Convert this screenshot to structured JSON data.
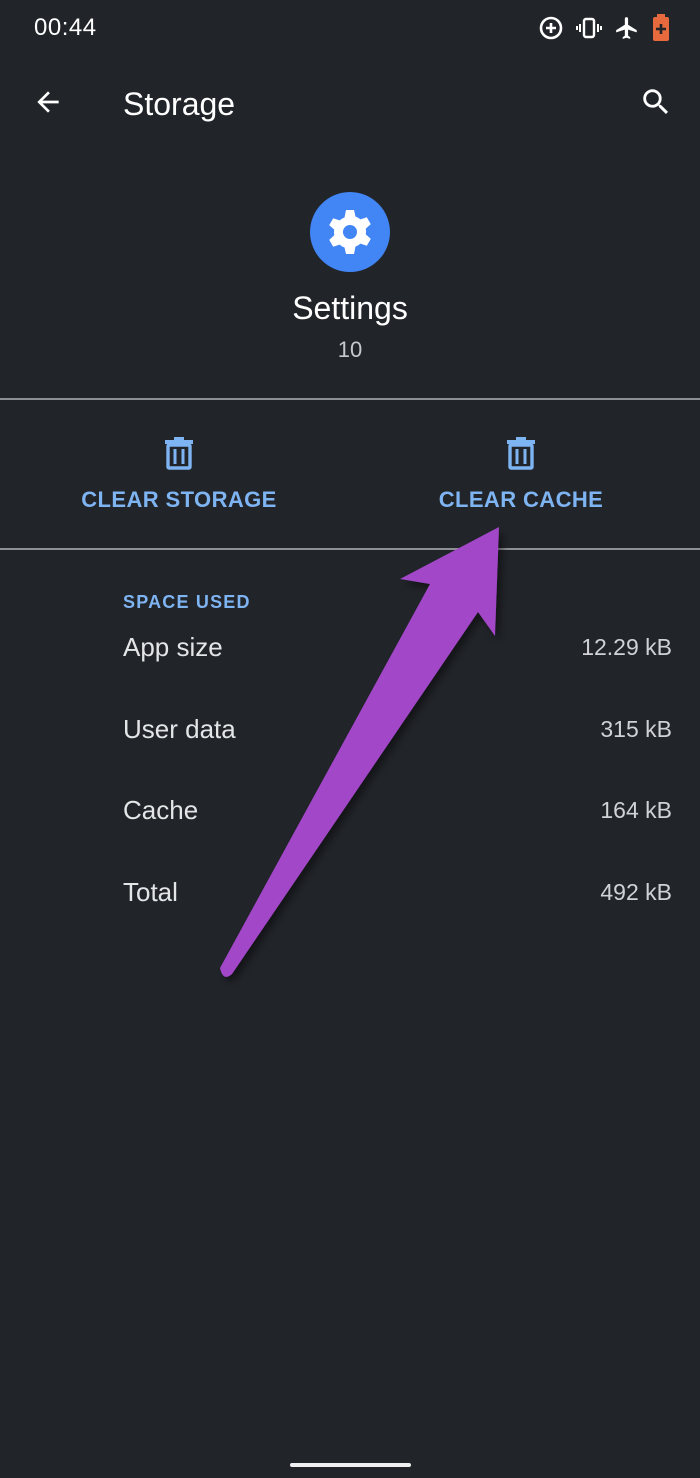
{
  "status_bar": {
    "time": "00:44",
    "icons": [
      "data-saver-icon",
      "vibrate-icon",
      "airplane-icon",
      "battery-saver-icon"
    ]
  },
  "app_bar": {
    "title": "Storage",
    "back_icon": "arrow-left-icon",
    "search_icon": "search-icon"
  },
  "app_info": {
    "name": "Settings",
    "version": "10",
    "icon": "gear-icon"
  },
  "actions": {
    "clear_storage": "CLEAR STORAGE",
    "clear_cache": "CLEAR CACHE"
  },
  "space_used": {
    "header": "SPACE USED",
    "rows": [
      {
        "label": "App size",
        "value": "12.29 kB"
      },
      {
        "label": "User data",
        "value": "315 kB"
      },
      {
        "label": "Cache",
        "value": "164 kB"
      },
      {
        "label": "Total",
        "value": "492 kB"
      }
    ]
  },
  "colors": {
    "background": "#212429",
    "accent": "#7fb4f2",
    "app_icon_bg": "#4285f4",
    "annotation_arrow": "#a347c9"
  }
}
